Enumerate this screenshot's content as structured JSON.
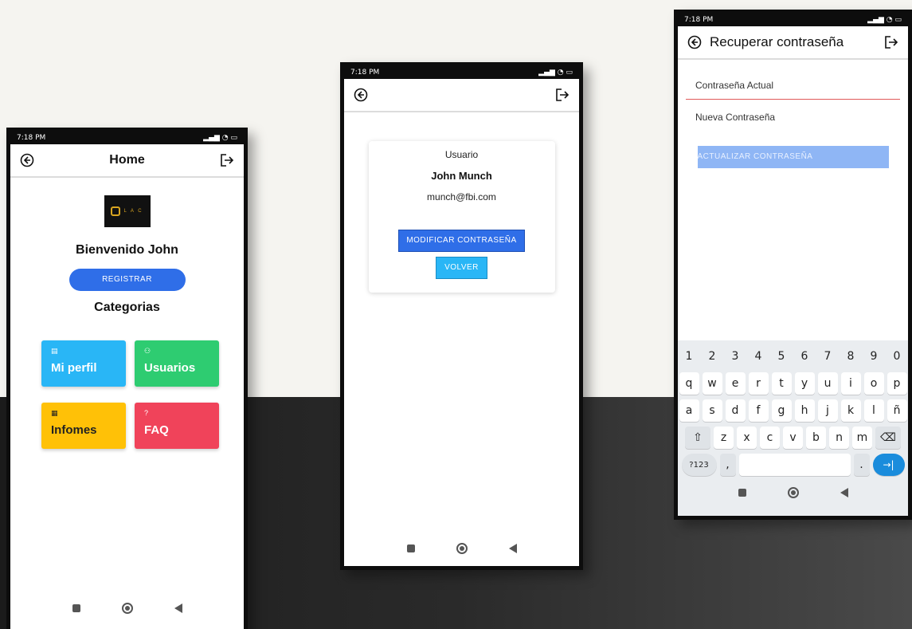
{
  "status": {
    "time": "7:18 PM"
  },
  "home": {
    "title": "Home",
    "logo_text": "L A C",
    "welcome": "Bienvenido John",
    "register_label": "REGISTRAR",
    "categories_title": "Categorias",
    "cards": [
      {
        "label": "Mi perfil",
        "icon": "profile-icon",
        "color": "#29b6f6"
      },
      {
        "label": "Usuarios",
        "icon": "users-icon",
        "color": "#2ecc71"
      },
      {
        "label": "Infomes",
        "icon": "report-icon",
        "color": "#ffc107"
      },
      {
        "label": "FAQ",
        "icon": "question-icon",
        "glyph": "?",
        "color": "#f0435a"
      }
    ]
  },
  "profile": {
    "label": "Usuario",
    "name": "John Munch",
    "email": "munch@fbi.com",
    "modify_label": "MODIFICAR CONTRASEÑA",
    "back_label": "VOLVER"
  },
  "recover": {
    "title": "Recuperar contraseña",
    "current_placeholder": "Contraseña Actual",
    "new_placeholder": "Nueva Contraseña",
    "update_label": "ACTUALIZAR CONTRASEÑA"
  },
  "keyboard": {
    "numbers": [
      "1",
      "2",
      "3",
      "4",
      "5",
      "6",
      "7",
      "8",
      "9",
      "0"
    ],
    "row1": [
      "q",
      "w",
      "e",
      "r",
      "t",
      "y",
      "u",
      "i",
      "o",
      "p"
    ],
    "row2": [
      "a",
      "s",
      "d",
      "f",
      "g",
      "h",
      "j",
      "k",
      "l",
      "ñ"
    ],
    "row3": [
      "z",
      "x",
      "c",
      "v",
      "b",
      "n",
      "m"
    ],
    "sym_label": "?123",
    "comma": ",",
    "period": "."
  }
}
